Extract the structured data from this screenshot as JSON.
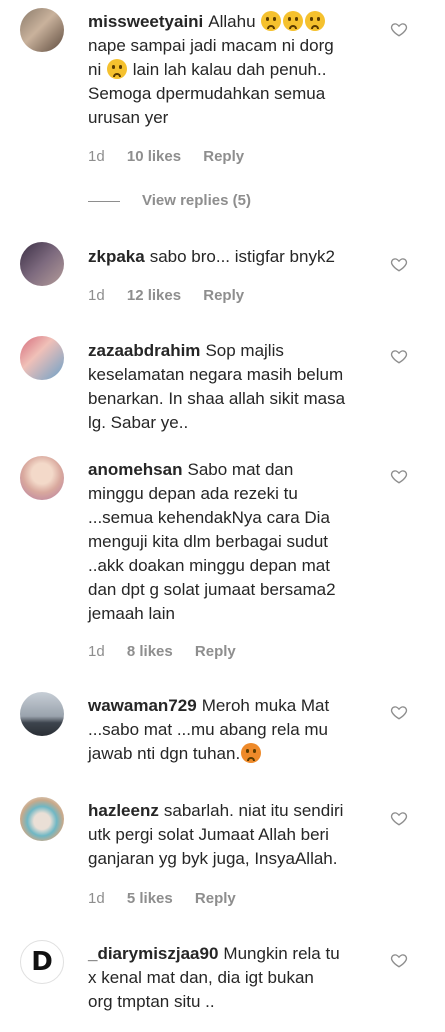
{
  "comments": [
    {
      "username": "missweetyaini",
      "text_parts": [
        "Allahu ",
        " ",
        " ",
        "\nnape sampai jadi macam ni dorg ni ",
        " lain lah kalau dah penuh.. Semoga dpermudahkan semua urusan yer"
      ],
      "time": "1d",
      "likes": "10 likes",
      "reply": "Reply",
      "view_replies": "View replies (5)"
    },
    {
      "username": "zkpaka",
      "text": "sabo bro... istigfar bnyk2",
      "time": "1d",
      "likes": "12 likes",
      "reply": "Reply"
    },
    {
      "username": "zazaabdrahim",
      "text": "Sop majlis keselamatan negara masih belum benarkan. In shaa allah sikit masa lg. Sabar ye..",
      "time": "",
      "likes": "",
      "reply": ""
    },
    {
      "username": "anomehsan",
      "text": "Sabo mat dan minggu depan ada rezeki tu ...semua kehendakNya cara Dia menguji kita dlm berbagai sudut ..akk doakan minggu depan mat dan dpt g solat jumaat bersama2 jemaah lain",
      "time": "1d",
      "likes": "8 likes",
      "reply": "Reply"
    },
    {
      "username": "wawaman729",
      "text": "Meroh muka Mat ...sabo mat ...mu abang rela mu jawab nti dgn tuhan.",
      "time": "",
      "likes": "",
      "reply": ""
    },
    {
      "username": "hazleenz",
      "text": "sabarlah. niat itu sendiri utk pergi solat Jumaat Allah beri ganjaran yg byk juga, InsyaAllah.",
      "time": "1d",
      "likes": "5 likes",
      "reply": "Reply"
    },
    {
      "username": "_diarymiszjaa90",
      "text": "Mungkin rela tu x kenal mat dan, dia igt bukan org tmptan situ ..",
      "avatar_letter": "D"
    }
  ],
  "colors": {
    "text": "#262626",
    "secondary": "#8e8e8e",
    "background": "#ffffff"
  },
  "icons": {
    "like": "heart-outline-icon",
    "emoji_sad": "sad-face-emoji",
    "emoji_angry": "angry-face-emoji"
  }
}
